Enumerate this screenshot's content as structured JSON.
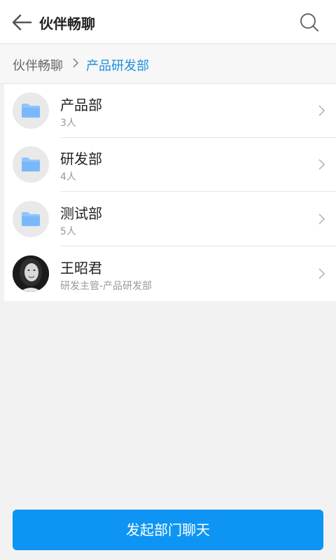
{
  "header": {
    "title": "伙伴畅聊",
    "back_icon": "arrow-left-icon",
    "search_icon": "search-icon"
  },
  "breadcrumb": {
    "root": "伙伴畅聊",
    "current": "产品研发部"
  },
  "list": {
    "items": [
      {
        "name": "产品部",
        "sub": "3人",
        "icon": "folder-icon"
      },
      {
        "name": "研发部",
        "sub": "4人",
        "icon": "folder-icon"
      },
      {
        "name": "测试部",
        "sub": "5人",
        "icon": "folder-icon"
      },
      {
        "name": "王昭君",
        "sub": "研发主管-产品研发部",
        "icon": "avatar-photo"
      }
    ]
  },
  "footer": {
    "button_label": "发起部门聊天"
  },
  "colors": {
    "accent": "#0e95f3",
    "breadcrumb_active": "#1a8fe0",
    "folder": "#8ec5ff"
  }
}
